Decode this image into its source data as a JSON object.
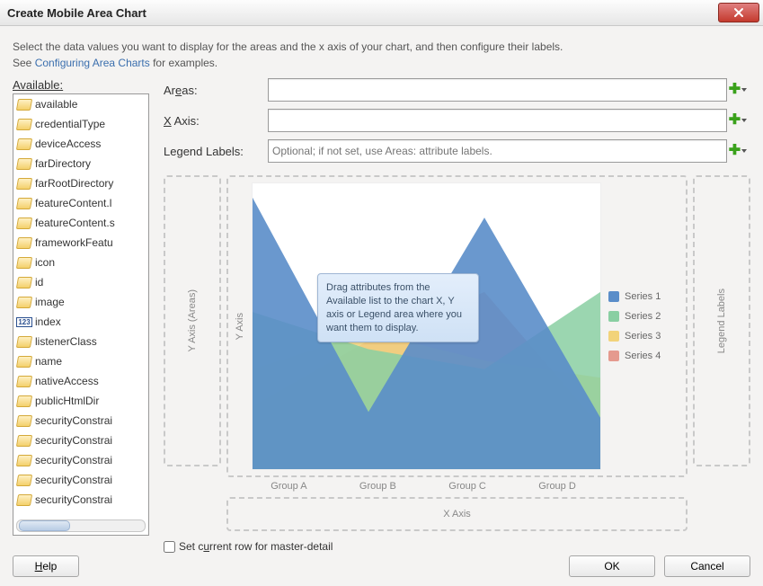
{
  "window": {
    "title": "Create Mobile Area Chart"
  },
  "desc": {
    "line1": "Select the data values you want to display for the areas and the x axis of your chart, and then configure their labels.",
    "line2a": "See ",
    "link": "Configuring Area Charts",
    "line2b": " for examples."
  },
  "available": {
    "heading": "Available:",
    "items": [
      {
        "t": "tag",
        "label": "available"
      },
      {
        "t": "tag",
        "label": "credentialType"
      },
      {
        "t": "tag",
        "label": "deviceAccess"
      },
      {
        "t": "tag",
        "label": "farDirectory"
      },
      {
        "t": "tag",
        "label": "farRootDirectory"
      },
      {
        "t": "tag",
        "label": "featureContent.l"
      },
      {
        "t": "tag",
        "label": "featureContent.s"
      },
      {
        "t": "tag",
        "label": "frameworkFeatu"
      },
      {
        "t": "tag",
        "label": "icon"
      },
      {
        "t": "tag",
        "label": "id"
      },
      {
        "t": "tag",
        "label": "image"
      },
      {
        "t": "num",
        "label": "index"
      },
      {
        "t": "tag",
        "label": "listenerClass"
      },
      {
        "t": "tag",
        "label": "name"
      },
      {
        "t": "tag",
        "label": "nativeAccess"
      },
      {
        "t": "tag",
        "label": "publicHtmlDir"
      },
      {
        "t": "tag",
        "label": "securityConstrai"
      },
      {
        "t": "tag",
        "label": "securityConstrai"
      },
      {
        "t": "tag",
        "label": "securityConstrai"
      },
      {
        "t": "tag",
        "label": "securityConstrai"
      },
      {
        "t": "tag",
        "label": "securityConstrai"
      }
    ]
  },
  "fields": {
    "areas_label_pre": "Ar",
    "areas_label_und": "e",
    "areas_label_post": "as:",
    "xaxis_label_und": "X",
    "xaxis_label_post": " Axis:",
    "legend_label": "Legend Labels:",
    "areas_value": "",
    "xaxis_value": "",
    "legend_placeholder": "Optional; if not set, use Areas: attribute labels."
  },
  "preview": {
    "ydrop": "Y Axis (Areas)",
    "yaxis": "Y Axis",
    "xaxis": "X Axis",
    "legenddrop": "Legend Labels",
    "tip": "Drag attributes from the Available list to the chart X, Y axis or Legend area where you want them to display."
  },
  "chart_data": {
    "type": "area",
    "categories": [
      "Group A",
      "Group B",
      "Group C",
      "Group D"
    ],
    "series": [
      {
        "name": "Series 1",
        "values": [
          95,
          20,
          88,
          18
        ],
        "color": "#5a8dc9"
      },
      {
        "name": "Series 2",
        "values": [
          55,
          42,
          35,
          62
        ],
        "color": "#89cfa2"
      },
      {
        "name": "Series 3",
        "values": [
          35,
          48,
          38,
          32
        ],
        "color": "#f2d37a"
      },
      {
        "name": "Series 4",
        "values": [
          22,
          45,
          62,
          15
        ],
        "color": "#e59a8e"
      }
    ],
    "ylim": [
      0,
      100
    ]
  },
  "checkbox": {
    "pre": "Set c",
    "und": "u",
    "post": "rrent row for master-detail",
    "checked": false
  },
  "buttons": {
    "help_pre": "",
    "help_und": "H",
    "help_post": "elp",
    "ok": "OK",
    "cancel": "Cancel"
  }
}
